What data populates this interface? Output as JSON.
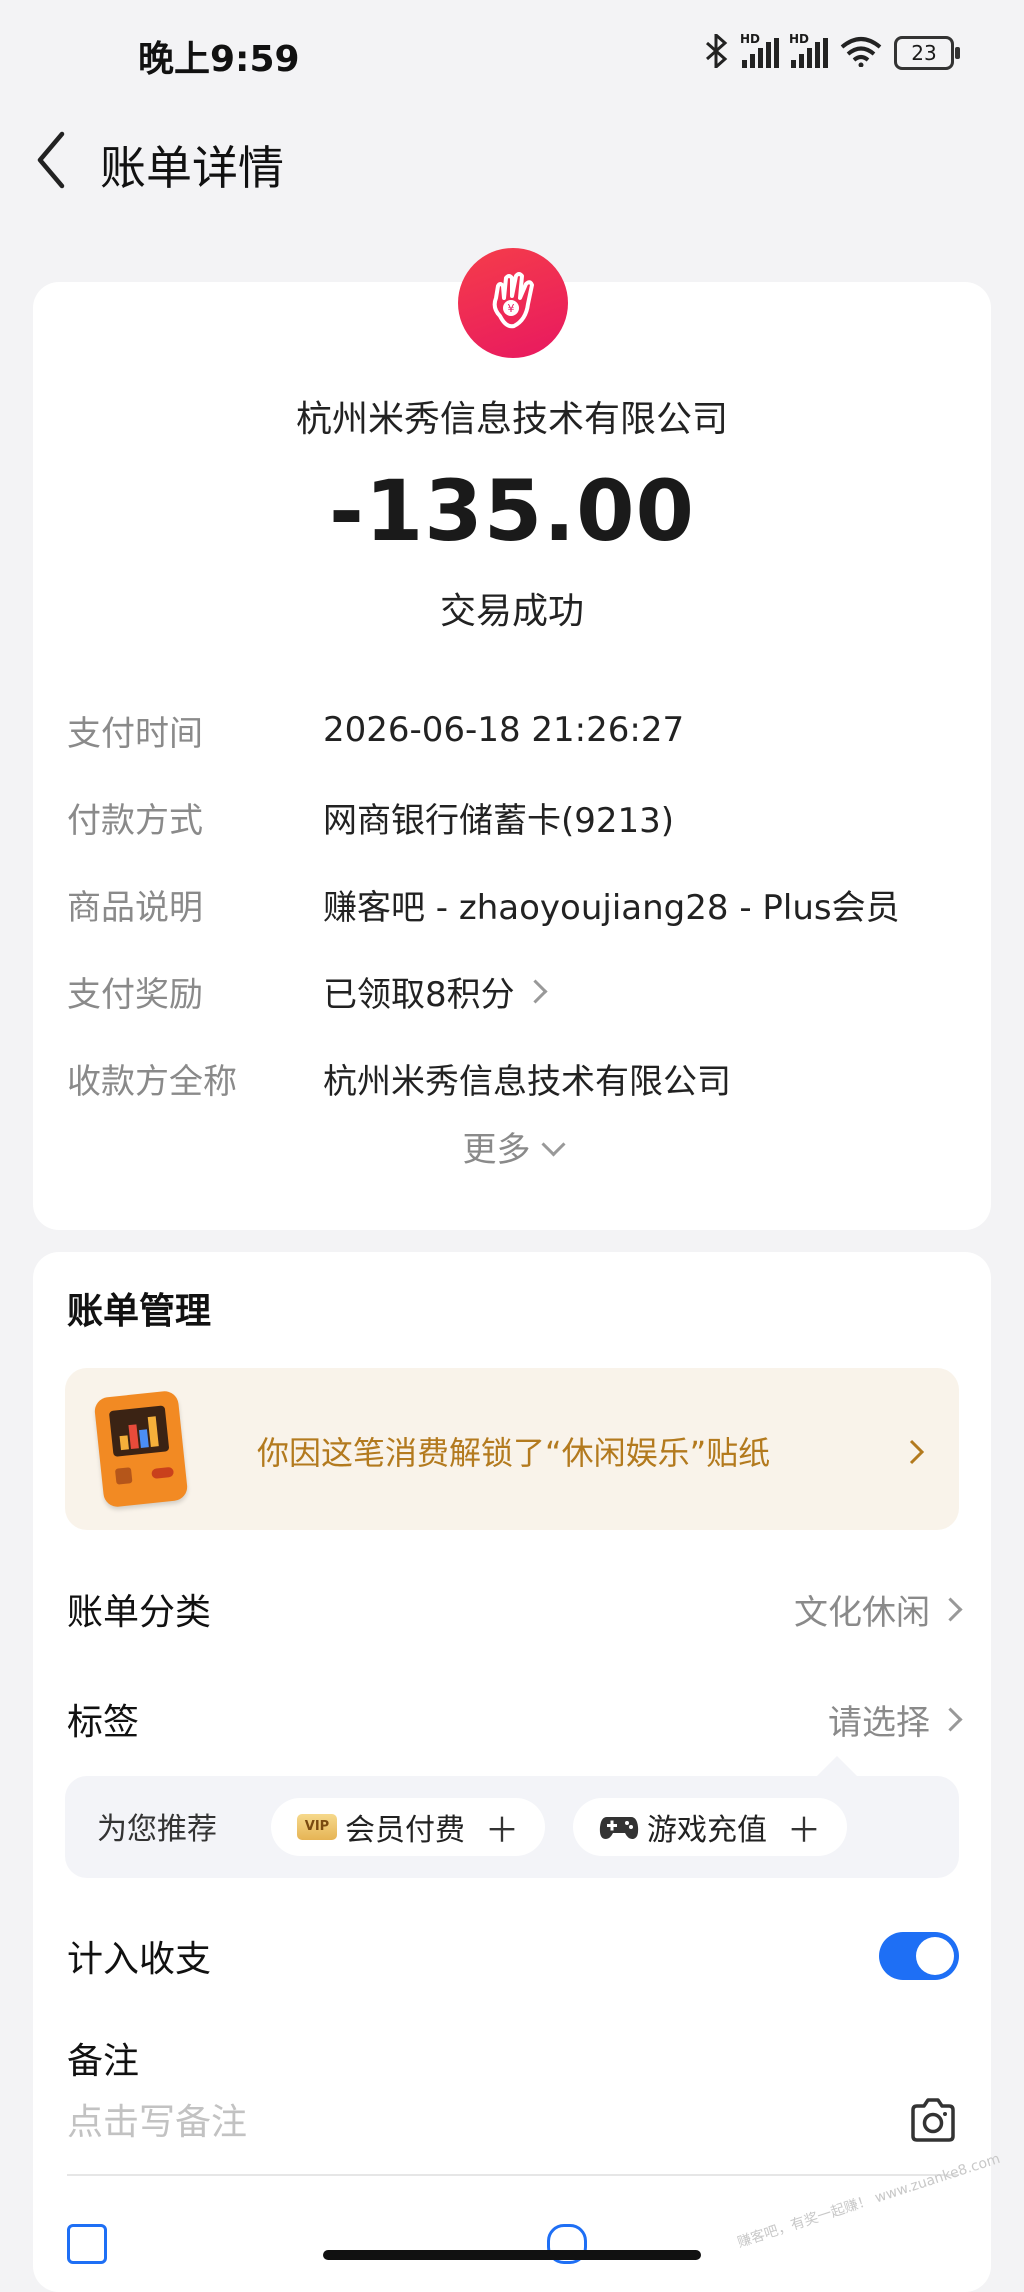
{
  "status_bar": {
    "time": "晚上9:59",
    "battery": "23",
    "signal1_label": "HD",
    "signal2_label": "HD"
  },
  "header": {
    "title": "账单详情"
  },
  "bill": {
    "merchant": "杭州米秀信息技术有限公司",
    "amount": "-135.00",
    "status": "交易成功",
    "details": [
      {
        "label": "支付时间",
        "value": "2026-06-18 21:26:27"
      },
      {
        "label": "付款方式",
        "value": "网商银行储蓄卡(9213)"
      },
      {
        "label": "商品说明",
        "value": "赚客吧 - zhaoyoujiang28 - Plus会员"
      },
      {
        "label": "支付奖励",
        "value": "已领取8积分"
      },
      {
        "label": "收款方全称",
        "value": "杭州米秀信息技术有限公司"
      }
    ],
    "more": "更多"
  },
  "management": {
    "title": "账单管理",
    "sticker_text": "你因这笔消费解锁了“休闲娱乐”贴纸",
    "category_label": "账单分类",
    "category_value": "文化休闲",
    "tag_label": "标签",
    "tag_value": "请选择",
    "recommend_label": "为您推荐",
    "chips": [
      {
        "badge": "VIP",
        "label": "会员付费",
        "icon": "vip-icon"
      },
      {
        "label": "游戏充值",
        "icon": "gamepad-icon"
      }
    ],
    "chip_plus": "＋",
    "include_label": "计入收支",
    "include_enabled": true,
    "note_label": "备注",
    "note_placeholder": "点击写备注",
    "note_value": ""
  },
  "watermark": "赚客吧，有奖一起赚！ www.zuanke8.com",
  "colors": {
    "accent": "#1e6ff5",
    "logo_red": "#f0304e",
    "sticker_text": "#b37a1e"
  }
}
